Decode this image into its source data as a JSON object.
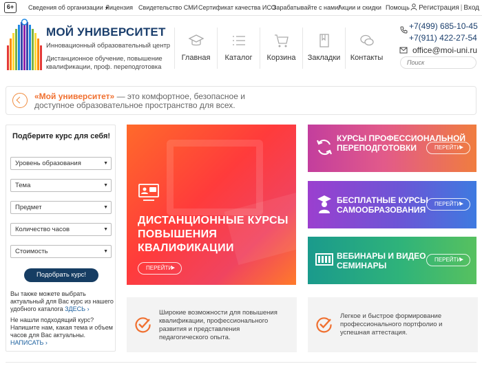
{
  "topbar": {
    "age_badge": "6+",
    "nav": [
      "Сведения об организации",
      "Лицензия",
      "Свидетельство СМИ",
      "Сертификат качества ИСО",
      "Зарабатывайте с нами!",
      "Акции и скидки",
      "Помощь"
    ],
    "register": "Регистрация",
    "login": "Вход"
  },
  "header": {
    "title": "МОЙ УНИВЕРСИТЕТ",
    "subtitle": "Инновационный образовательный центр",
    "description": "Дистанционное обучение, повышение квалификации, проф. переподготовка",
    "nav": [
      {
        "label": "Главная",
        "icon": "graduation-cap-icon"
      },
      {
        "label": "Каталог",
        "icon": "list-icon"
      },
      {
        "label": "Корзина",
        "icon": "cart-icon"
      },
      {
        "label": "Закладки",
        "icon": "bookmark-icon"
      },
      {
        "label": "Контакты",
        "icon": "chat-icon"
      }
    ],
    "phones": [
      "+7(499) 685-10-45",
      "+7(911) 422-27-54"
    ],
    "email": "office@moi-uni.ru",
    "search_placeholder": "Поиск"
  },
  "slogan": {
    "brand": "«Мой университет»",
    "text": " — это комфортное, безопасное и доступное образовательное пространство для всех."
  },
  "filter": {
    "title": "Подберите курс для себя!",
    "selects": [
      "Уровень образования",
      "Тема",
      "Предмет",
      "Количество часов",
      "Стоимость"
    ],
    "button": "Подобрать курс!",
    "note1": "Вы также можете выбрать актуальный для Вас курс из нашего удобного каталога",
    "note1_link": "ЗДЕСЬ",
    "note2": "Не нашли подходящий курс? Напишите нам, какая тема и объем часов для Вас актуальны.",
    "note2_link": "НАПИСАТЬ"
  },
  "promo_big": {
    "title": "ДИСТАНЦИОННЫЕ КУРСЫ ПОВЫШЕНИЯ КВАЛИФИКАЦИИ",
    "button": "ПЕРЕЙТИ"
  },
  "promos": [
    {
      "title": "КУРСЫ ПРОФЕССИОНАЛЬНОЙ ПЕРЕПОДГОТОВКИ",
      "button": "ПЕРЕЙТИ"
    },
    {
      "title": "БЕСПЛАТНЫЕ КУРСЫ САМООБРАЗОВАНИЯ",
      "button": "ПЕРЕЙТИ"
    },
    {
      "title": "ВЕБИНАРЫ И ВИДЕО СЕМИНАРЫ",
      "button": "ПЕРЕЙТИ"
    }
  ],
  "benefits": [
    "Широкие возможности для повышения квалификации, профессионального развития и представления педагогического опыта.",
    "Легкое и быстрое формирование профессионального портфолио и успешная аттестация."
  ],
  "colors": {
    "brand_dark": "#163d63",
    "accent_orange": "#f07030"
  }
}
